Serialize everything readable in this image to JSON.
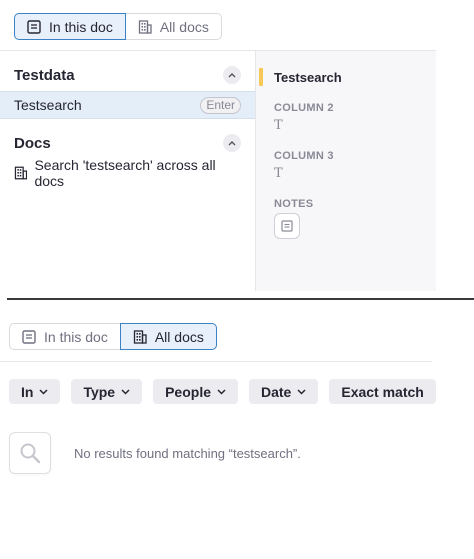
{
  "top_panel": {
    "scope_tabs": [
      {
        "label": "In this doc",
        "active": true,
        "icon": "page-icon"
      },
      {
        "label": "All docs",
        "active": false,
        "icon": "building-icon"
      }
    ],
    "sections": [
      {
        "title": "Testdata",
        "collapse_icon": "chevron-up-icon"
      },
      {
        "title": "Docs",
        "collapse_icon": "chevron-up-icon"
      }
    ],
    "selected_result": {
      "label": "Testsearch",
      "shortcut": "Enter"
    },
    "docs_result": {
      "label": "Search 'testsearch' across all docs",
      "icon": "building-icon"
    },
    "preview": {
      "title": "Testsearch",
      "accent_color": "#f6c859",
      "fields": [
        {
          "label": "COLUMN 2",
          "type_icon": "T"
        },
        {
          "label": "COLUMN 3",
          "type_icon": "T"
        },
        {
          "label": "NOTES",
          "type_icon": "notes-icon"
        }
      ]
    }
  },
  "bottom_panel": {
    "scope_tabs": [
      {
        "label": "In this doc",
        "active": false,
        "icon": "page-icon"
      },
      {
        "label": "All docs",
        "active": true,
        "icon": "building-icon"
      }
    ],
    "filters": [
      {
        "label": "In",
        "dropdown": true
      },
      {
        "label": "Type",
        "dropdown": true
      },
      {
        "label": "People",
        "dropdown": true
      },
      {
        "label": "Date",
        "dropdown": true
      },
      {
        "label": "Exact match",
        "dropdown": false
      }
    ],
    "empty_state": {
      "icon": "search-icon",
      "message": "No results found matching “testsearch”."
    }
  },
  "colors": {
    "accent_blue": "#3b82c4",
    "selected_bg": "#e4eef8",
    "preview_bg": "#f7f7f9"
  }
}
